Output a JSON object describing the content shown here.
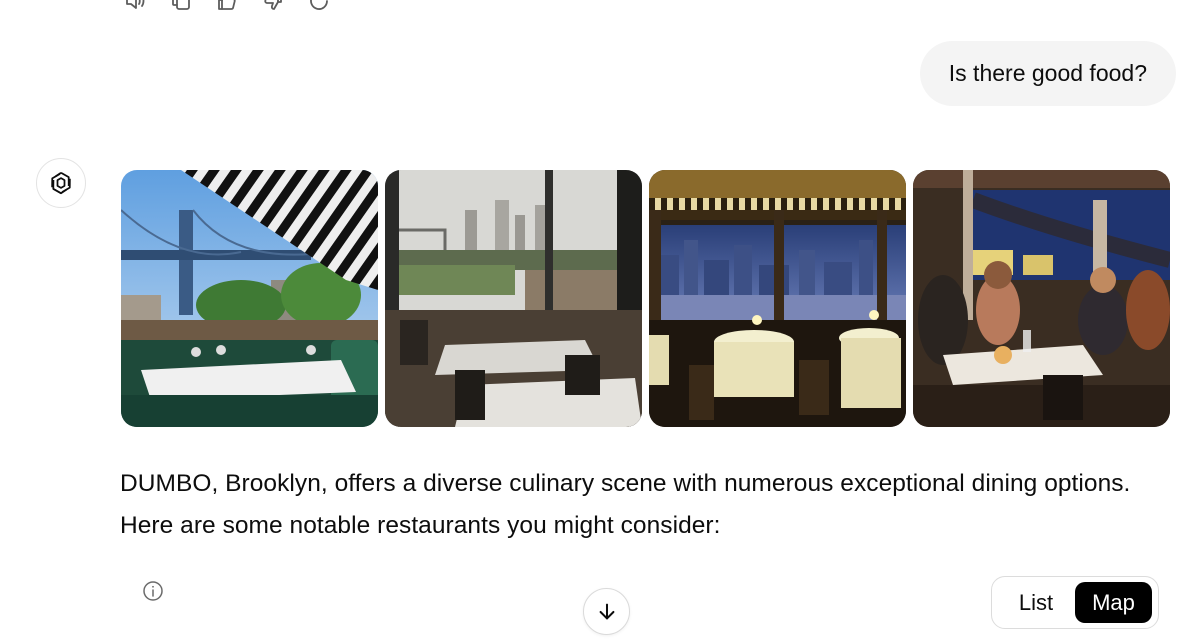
{
  "message_actions": [
    {
      "name": "read-aloud-icon"
    },
    {
      "name": "copy-icon"
    },
    {
      "name": "thumbs-up-icon"
    },
    {
      "name": "thumbs-down-icon"
    },
    {
      "name": "regenerate-icon"
    }
  ],
  "user_message": {
    "text": "Is there good food?"
  },
  "assistant": {
    "avatar_icon": "openai-logo-icon",
    "gallery": [
      {
        "name": "restaurant-photo-1",
        "description_icon": "image"
      },
      {
        "name": "restaurant-photo-2",
        "description_icon": "image"
      },
      {
        "name": "restaurant-photo-3",
        "description_icon": "image"
      },
      {
        "name": "restaurant-photo-4",
        "description_icon": "image"
      }
    ],
    "answer_text": "DUMBO, Brooklyn, offers a diverse culinary scene with numerous exceptional dining options. Here are some notable restaurants you might consider:"
  },
  "controls": {
    "info_icon": "info-icon",
    "scroll_icon": "arrow-down-icon",
    "view_toggle": {
      "list_label": "List",
      "map_label": "Map",
      "selected": "Map"
    }
  },
  "colors": {
    "bubble_bg": "#f4f4f4",
    "toggle_active_bg": "#000000",
    "text": "#0d0d0d"
  }
}
